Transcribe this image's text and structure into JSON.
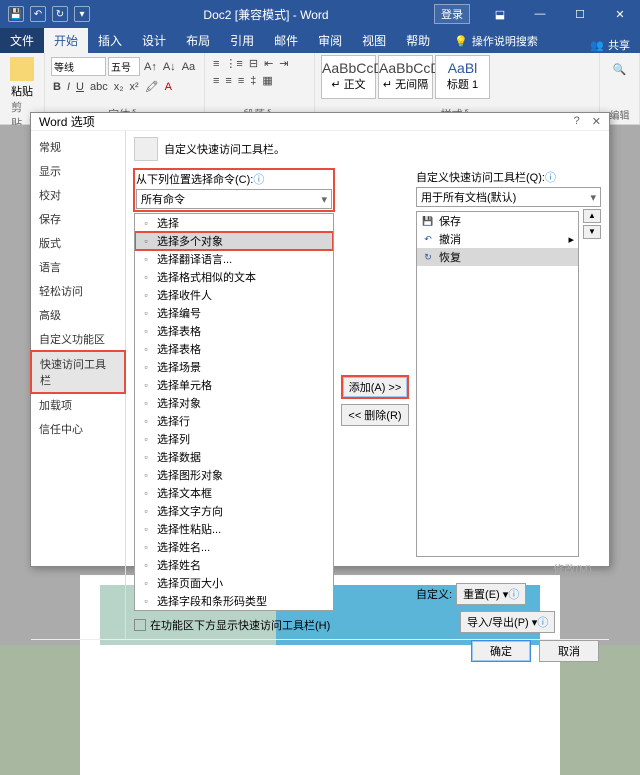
{
  "titlebar": {
    "title": "Doc2 [兼容模式] - Word",
    "login": "登录"
  },
  "tabs": {
    "file": "文件",
    "home": "开始",
    "insert": "插入",
    "design": "设计",
    "layout": "布局",
    "references": "引用",
    "mailings": "邮件",
    "review": "审阅",
    "view": "视图",
    "help": "帮助",
    "search": "操作说明搜索",
    "share": "共享"
  },
  "ribbon": {
    "clipboard": {
      "paste": "粘贴",
      "label": "剪贴板"
    },
    "font": {
      "family": "等线",
      "size": "五号",
      "label": "字体"
    },
    "paragraph": {
      "label": "段落"
    },
    "styles": {
      "items": [
        {
          "sample": "AaBbCcD",
          "name": "↵ 正文"
        },
        {
          "sample": "AaBbCcD",
          "name": "↵ 无间隔"
        },
        {
          "sample": "AaBl",
          "name": "标题 1"
        }
      ],
      "label": "样式"
    },
    "editing": {
      "label": "编辑"
    }
  },
  "dialog": {
    "title": "Word 选项",
    "sidebar": [
      "常规",
      "显示",
      "校对",
      "保存",
      "版式",
      "语言",
      "轻松访问",
      "高级",
      "自定义功能区",
      "快速访问工具栏",
      "加载项",
      "信任中心"
    ],
    "heading": "自定义快速访问工具栏。",
    "leftLabel": "从下列位置选择命令(C):",
    "leftCombo": "所有命令",
    "rightLabel": "自定义快速访问工具栏(Q):",
    "rightCombo": "用于所有文档(默认)",
    "commands": [
      "选择",
      "选择多个对象",
      "选择翻译语言...",
      "选择格式相似的文本",
      "选择收件人",
      "选择编号",
      "选择表格",
      "选择表格",
      "选择场景",
      "选择单元格",
      "选择对象",
      "选择行",
      "选择列",
      "选择数据",
      "选择图形对象",
      "选择文本框",
      "选择文字方向",
      "选择性粘贴...",
      "选择姓名...",
      "选择姓名",
      "选择页面大小",
      "选择字段和条形码类型"
    ],
    "rightList": [
      {
        "icon": "💾",
        "label": "保存"
      },
      {
        "icon": "↶",
        "label": "撤消"
      },
      {
        "icon": "↻",
        "label": "恢复"
      }
    ],
    "addBtn": "添加(A) >>",
    "removeBtn": "<< 删除(R)",
    "modifyLink": "修改(M)...",
    "customLabel": "自定义:",
    "resetBtn": "重置(E)",
    "importBtn": "导入/导出(P)",
    "checkbox": "在功能区下方显示快速访问工具栏(H)",
    "ok": "确定",
    "cancel": "取消"
  }
}
